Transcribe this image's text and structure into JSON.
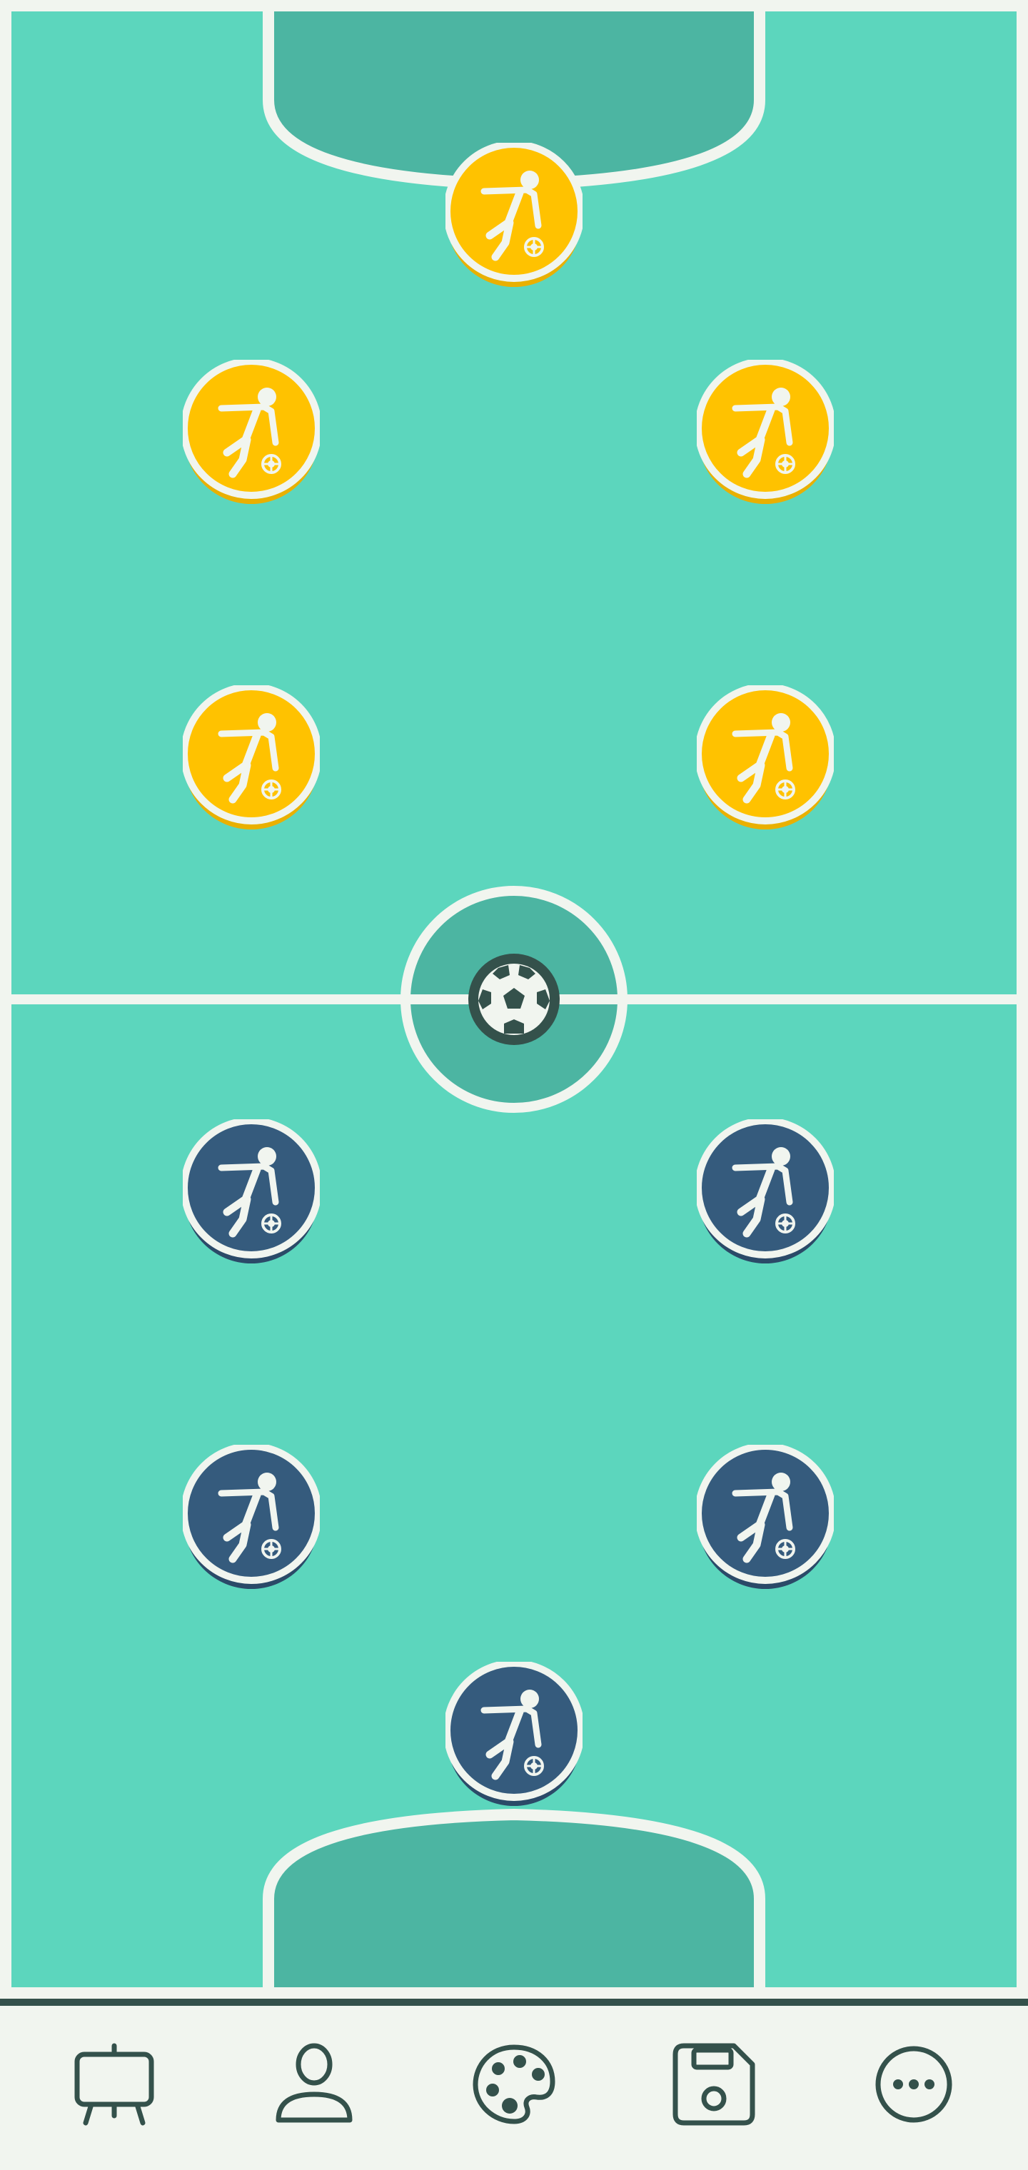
{
  "app": {
    "screen": "futsal-formation-board"
  },
  "colors": {
    "pitch": "#5cd6bd",
    "pitch_dark": "#4cb5a2",
    "lines": "#f1f5ef",
    "team_home": "#ffc200",
    "team_home_shadow": "#e9b000",
    "team_away": "#355b7d",
    "team_away_shadow": "#2b4a68",
    "toolbar_bg": "#f1f5ef",
    "toolbar_border": "#34514b",
    "icon": "#34514b"
  },
  "teams": [
    {
      "name": "yellow",
      "player_count": 5,
      "player_icon": "kicking-player-icon"
    },
    {
      "name": "blue",
      "player_count": 5,
      "player_icon": "kicking-player-icon"
    }
  ],
  "ball": {
    "icon": "soccer-ball-icon"
  },
  "toolbar": {
    "items": [
      {
        "id": "board",
        "icon": "easel-board-icon"
      },
      {
        "id": "players",
        "icon": "person-icon"
      },
      {
        "id": "colors",
        "icon": "palette-icon"
      },
      {
        "id": "save",
        "icon": "floppy-disk-icon"
      },
      {
        "id": "more",
        "icon": "more-dots-icon"
      }
    ]
  }
}
